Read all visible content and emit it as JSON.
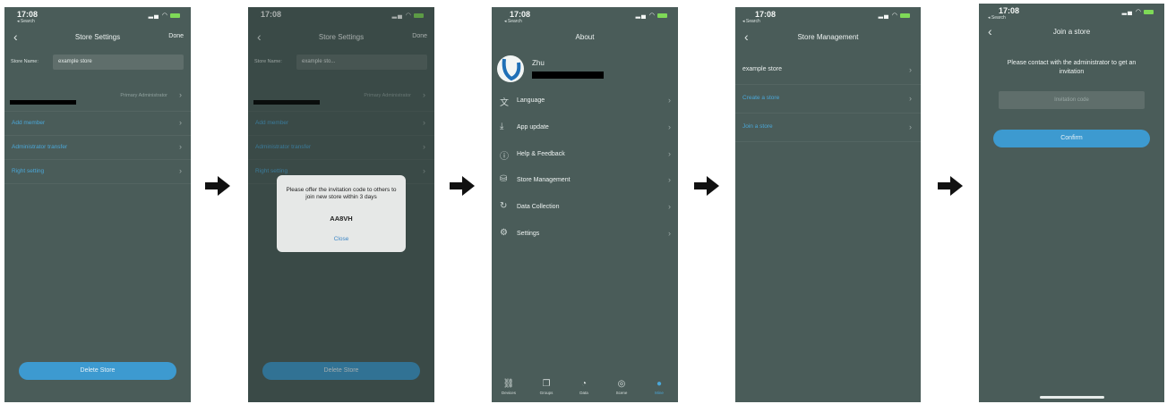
{
  "status": {
    "time": "17:08",
    "back_app": "◂ Search"
  },
  "screen1": {
    "title": "Store Settings",
    "done": "Done",
    "store_name_label": "Store Name:",
    "store_name_value": "example store",
    "primary_admin": "Primary Administrator",
    "rows": [
      "Add member",
      "Administrator transfer",
      "Right setting"
    ],
    "delete_button": "Delete Store"
  },
  "screen2": {
    "title": "Store Settings",
    "done": "Done",
    "store_name_label": "Store Name:",
    "store_name_value": "example sto...",
    "primary_admin": "Primary Administrator",
    "rows": [
      "Add member",
      "Administrator transfer",
      "Right setting"
    ],
    "delete_button": "Delete Store",
    "dialog": {
      "message": "Please offer the invitation code to others to join new store within 3 days",
      "code": "AA8VH",
      "close": "Close"
    }
  },
  "screen3": {
    "title": "About",
    "user_name": "Zhu",
    "items": [
      {
        "icon": "language-icon",
        "label": "Language"
      },
      {
        "icon": "download-icon",
        "label": "App update"
      },
      {
        "icon": "info-icon",
        "label": "Help & Feedback"
      },
      {
        "icon": "database-icon",
        "label": "Store Management"
      },
      {
        "icon": "refresh-icon",
        "label": "Data Collection"
      },
      {
        "icon": "gear-icon",
        "label": "Settings"
      }
    ],
    "tabs": [
      "Devices",
      "Groups",
      "Data",
      "Scene",
      "Mine"
    ]
  },
  "screen4": {
    "title": "Store Management",
    "rows": [
      "example store",
      "Create a store",
      "Join a store"
    ]
  },
  "screen5": {
    "title": "Join a store",
    "message": "Please contact with the administrator to get an invitation",
    "placeholder": "Invitation code",
    "confirm": "Confirm"
  },
  "colors": {
    "bg": "#4a5c59",
    "accent": "#3d9ad0",
    "link": "#4aa7d8"
  }
}
